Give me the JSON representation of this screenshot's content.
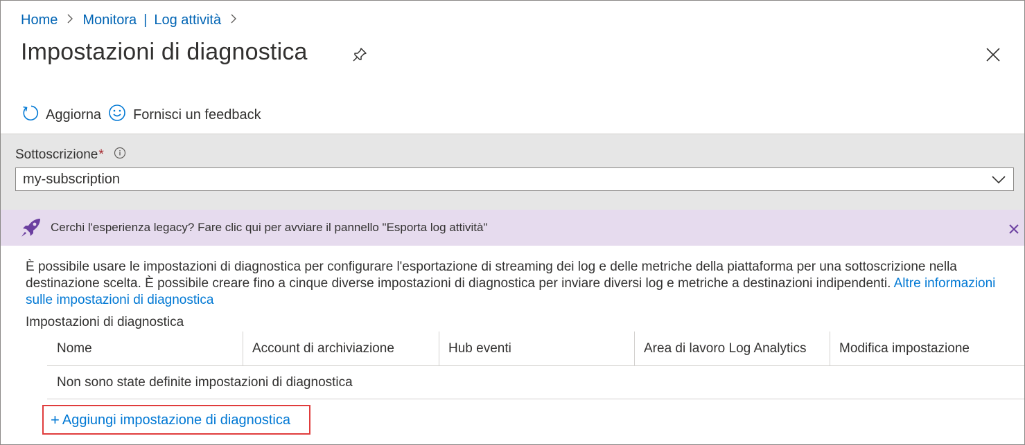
{
  "breadcrumb": {
    "home": "Home",
    "monitor": "Monitora",
    "separator_pipe": "|",
    "activity_log": "Log attività"
  },
  "page": {
    "title": "Impostazioni di diagnostica"
  },
  "toolbar": {
    "refresh_label": "Aggiorna",
    "feedback_label": "Fornisci un feedback"
  },
  "subscription": {
    "label": "Sottoscrizione",
    "required_marker": "*",
    "selected_value": "my-subscription"
  },
  "banner": {
    "text": "Cerchi l'esperienza legacy? Fare clic qui per avviare il pannello \"Esporta log attività\""
  },
  "description": {
    "text": "È possibile usare le impostazioni di diagnostica per configurare l'esportazione di streaming dei log e delle metriche della piattaforma per una sottoscrizione nella destinazione scelta. È possibile creare fino a cinque diverse impostazioni di diagnostica per inviare diversi log e metriche a destinazioni indipendenti. ",
    "link": "Altre informazioni sulle impostazioni di diagnostica"
  },
  "settings_table": {
    "label": "Impostazioni di diagnostica",
    "columns": [
      "Nome",
      "Account di archiviazione",
      "Hub eventi",
      "Area di lavoro Log Analytics",
      "Modifica impostazione"
    ],
    "empty_message": "Non sono state definite impostazioni di diagnostica"
  },
  "add_action": {
    "plus": "+",
    "label": "Aggiungi impostazione di diagnostica"
  },
  "colors": {
    "link": "#0078d4",
    "banner_bg": "#e6dbee",
    "panel_bg": "#e6e6e6",
    "highlight_border": "#e03c3c",
    "accent_purple": "#6b3fa0"
  }
}
